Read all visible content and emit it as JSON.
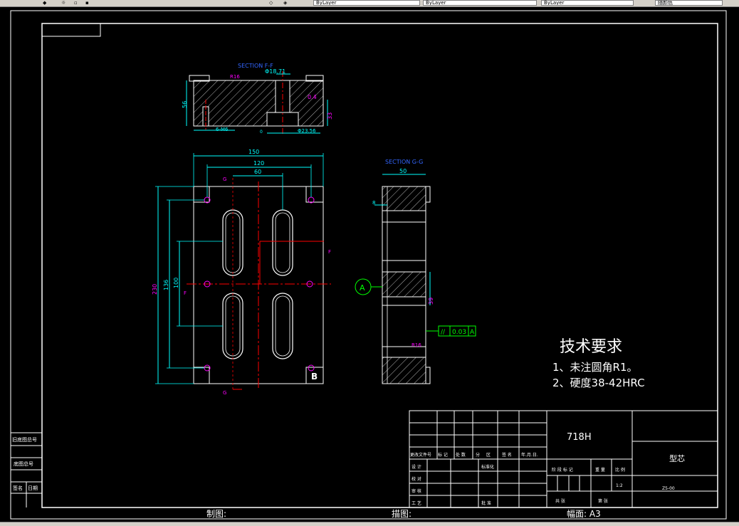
{
  "toolbar": {
    "layer_combo": "ByLayer",
    "linetype_combo": "ByLayer",
    "lineweight_combo": "ByLayer",
    "plotstyle_combo": "随颜色"
  },
  "drawing": {
    "section_ff": {
      "title": "SECTION F-F",
      "phi_top": "Φ18.71",
      "r_top": "R16",
      "d_56": "56",
      "d_04": "0.4",
      "d_bottom_hole": "6-M6",
      "phi_bottom": "Φ23.56",
      "d_33": "33",
      "d_tiny": "0"
    },
    "plan": {
      "d_150": "150",
      "d_120": "120",
      "d_60": "60",
      "d_230": "230",
      "d_136": "136",
      "d_100": "100",
      "f_left": "F",
      "f_right": "F",
      "g_top": "G",
      "g_bottom": "G",
      "b_mark": "B"
    },
    "section_gg": {
      "title": "SECTION G-G",
      "d_50": "50",
      "d_8": "8",
      "d_39": "39",
      "r_right": "R16",
      "datum": "A",
      "tol_symbol": "//",
      "tol_value": "0.03",
      "tol_datum": "A"
    },
    "tech_notes": {
      "heading": "技术要求",
      "line1": "1、未注圆角R1。",
      "line2": "2、硬度38-42HRC"
    }
  },
  "title_block": {
    "material": "718H",
    "part_name": "型芯",
    "scale": "1:2",
    "drawing_number": "Z5-00",
    "header_row": [
      "更改文件号",
      "标 记",
      "处 数",
      "分",
      "区",
      "签 名",
      "年.月.日."
    ],
    "left_labels": [
      "设 计",
      "校 对",
      "审 核",
      "工 艺"
    ],
    "standardize": "标准化",
    "approve": "批 准",
    "stage_label": "阶 段 标 记",
    "weight_label": "重 量",
    "ratio_label": "比 例",
    "total_sheets": "共  张",
    "sheet_no": "第  张"
  },
  "left_strip": {
    "label1": "旧底图总号",
    "label2": "底图总号",
    "label3": "签名",
    "label4": "日期"
  },
  "bottom_fields": {
    "drawn": "制图:",
    "traced": "描图:",
    "format": "幅面: A3"
  },
  "colors": {
    "border": "#ffffff",
    "dimension": "#00ffff",
    "section_label": "#0000ff",
    "center": "#ff0000",
    "hatch": "#ffffff",
    "magenta": "#ff00ff",
    "green": "#00ff00"
  }
}
